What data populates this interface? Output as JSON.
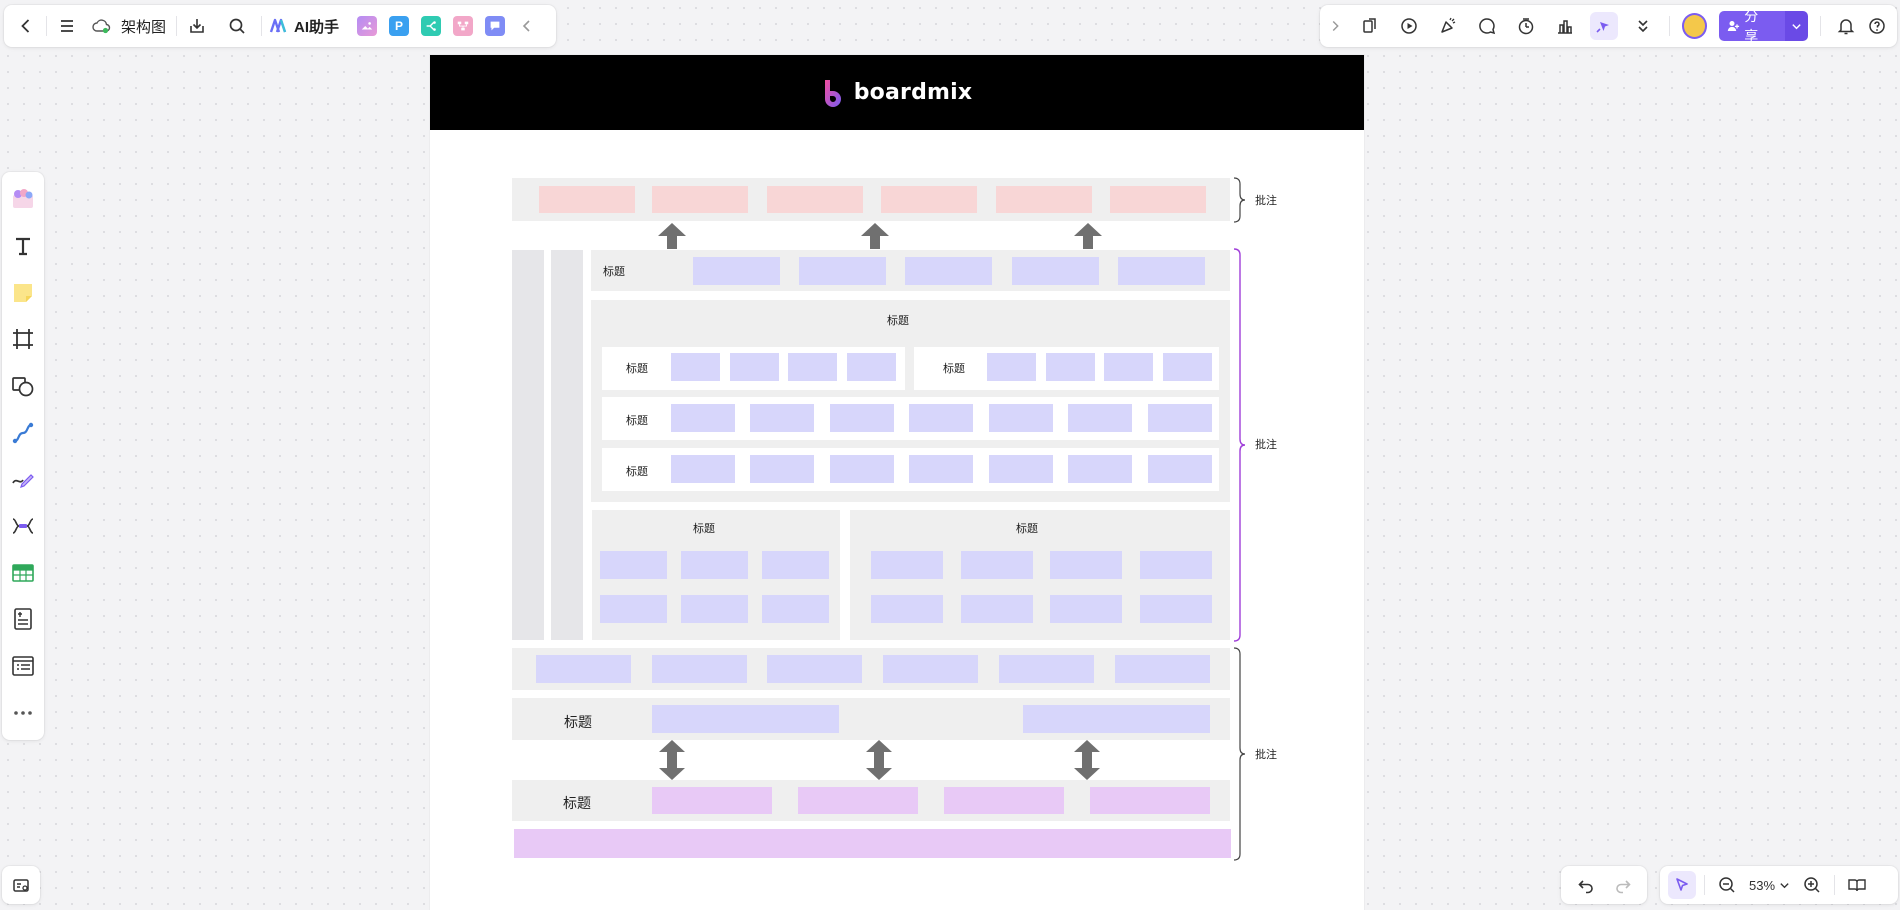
{
  "top_left_toolbar": {
    "doc_title": "架构图",
    "ai_label": "AI助手",
    "app_p_label": "P"
  },
  "top_right_toolbar": {
    "share_label": "分享"
  },
  "bottom_right": {
    "zoom_level": "53%"
  },
  "canvas": {
    "brand": "boardmix",
    "section_label": "标题",
    "note_label": "批注"
  },
  "colors": {
    "accent": "#7b5cf0",
    "pink_block": "#f8d6d6",
    "blue_block": "#d7d6fb",
    "violet_block": "#e8c9f6",
    "gray_panel": "#efefef"
  }
}
